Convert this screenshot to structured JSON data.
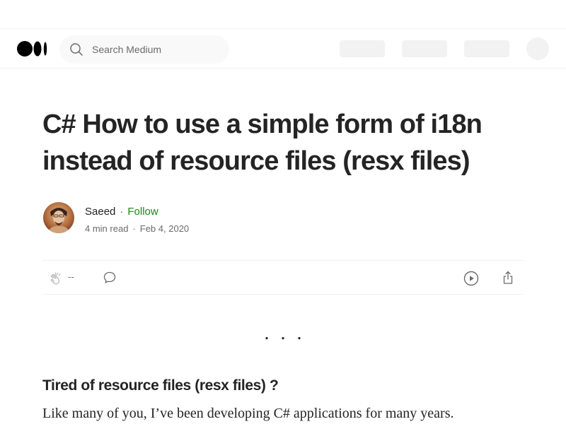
{
  "header": {
    "logo_icon": "medium-logo-icon",
    "search": {
      "icon": "search-icon",
      "placeholder": "Search Medium"
    }
  },
  "article": {
    "title": "C# How to use a simple form of i18n instead of resource files (resx files)",
    "author": {
      "name": "Saeed",
      "separator": "·",
      "follow_label": "Follow",
      "avatar_icon": "author-avatar"
    },
    "meta": {
      "read_time": "4 min read",
      "separator": "·",
      "date": "Feb 4, 2020"
    },
    "actions": {
      "clap_icon": "clap-icon",
      "clap_count": "--",
      "comment_icon": "comment-icon",
      "listen_icon": "play-icon",
      "share_icon": "share-icon"
    },
    "section_separator": "...",
    "subheading": "Tired of resource files (resx files) ?",
    "body_first_line": "Like many of you, I’ve been developing C# applications for many years."
  },
  "colors": {
    "text": "#242424",
    "muted": "#6b6b6b",
    "follow": "#1a8917",
    "placeholder_bg": "#f2f2f2"
  }
}
